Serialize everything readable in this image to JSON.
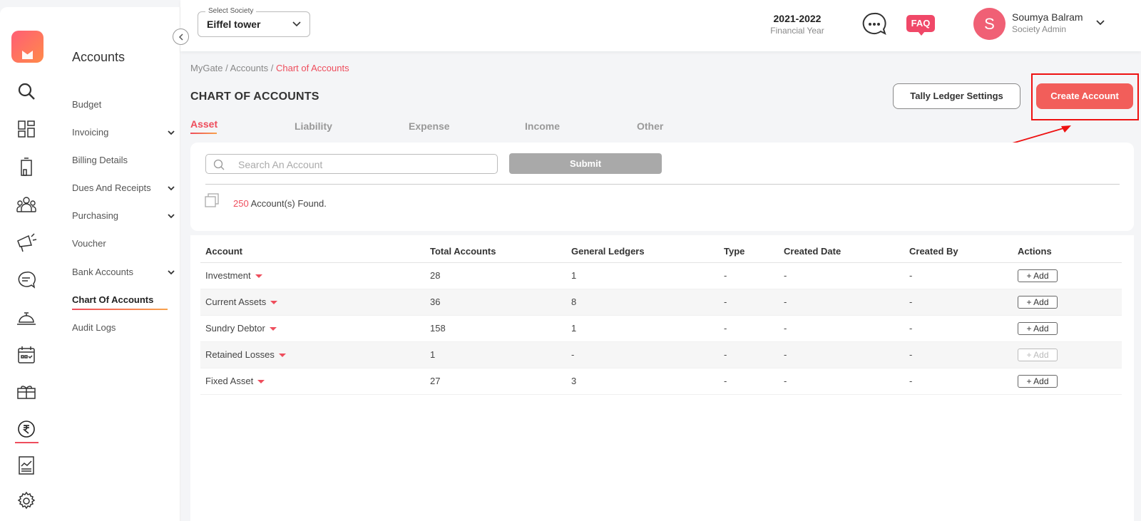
{
  "colors": {
    "accent": "#ee4d5c",
    "primary_button": "#f25e5a",
    "submit_button": "#a9a9a9",
    "annotation": "#e11111"
  },
  "rail": {
    "icons": [
      "search-icon",
      "dashboard-icon",
      "building-icon",
      "users-icon",
      "megaphone-icon",
      "chat-bubble-icon",
      "reception-bell-icon",
      "calendar-icon",
      "gift-icon",
      "rupee-icon",
      "report-icon",
      "gear-icon"
    ],
    "active": "rupee-icon"
  },
  "submenu": {
    "title": "Accounts",
    "items": [
      {
        "label": "Budget",
        "has_chevron": false
      },
      {
        "label": "Invoicing",
        "has_chevron": true
      },
      {
        "label": "Billing Details",
        "has_chevron": false
      },
      {
        "label": "Dues And Receipts",
        "has_chevron": true
      },
      {
        "label": "Purchasing",
        "has_chevron": true
      },
      {
        "label": "Voucher",
        "has_chevron": false
      },
      {
        "label": "Bank Accounts",
        "has_chevron": true
      },
      {
        "label": "Chart Of Accounts",
        "has_chevron": false,
        "active": true
      },
      {
        "label": "Audit Logs",
        "has_chevron": false
      }
    ]
  },
  "header": {
    "society_label": "Select Society",
    "society_value": "Eiffel tower",
    "financial_year": "2021-2022",
    "financial_year_label": "Financial Year",
    "faq_label": "FAQ",
    "user_initial": "S",
    "user_name": "Soumya Balram",
    "user_role": "Society Admin"
  },
  "breadcrumb": {
    "parts": [
      "MyGate",
      "Accounts"
    ],
    "current": "Chart of Accounts",
    "sep": " / "
  },
  "page_title": "CHART OF ACCOUNTS",
  "buttons": {
    "tally": "Tally Ledger Settings",
    "create": "Create Account",
    "submit": "Submit"
  },
  "tabs": [
    {
      "label": "Asset",
      "active": true
    },
    {
      "label": "Liability"
    },
    {
      "label": "Expense"
    },
    {
      "label": "Income"
    },
    {
      "label": "Other"
    }
  ],
  "search": {
    "placeholder": "Search An Account",
    "value": ""
  },
  "result": {
    "count": "250",
    "suffix": " Account(s) Found."
  },
  "table": {
    "headers": [
      "Account",
      "Total Accounts",
      "General Ledgers",
      "Type",
      "Created Date",
      "Created By",
      "Actions"
    ],
    "rows": [
      {
        "account": "Investment",
        "total": "28",
        "ledgers": "1",
        "type": "-",
        "created_date": "-",
        "created_by": "-",
        "action": "+ Add",
        "action_enabled": true
      },
      {
        "account": "Current Assets",
        "total": "36",
        "ledgers": "8",
        "type": "-",
        "created_date": "-",
        "created_by": "-",
        "action": "+ Add",
        "action_enabled": true
      },
      {
        "account": "Sundry Debtor",
        "total": "158",
        "ledgers": "1",
        "type": "-",
        "created_date": "-",
        "created_by": "-",
        "action": "+ Add",
        "action_enabled": true
      },
      {
        "account": "Retained Losses",
        "total": "1",
        "ledgers": "-",
        "type": "-",
        "created_date": "-",
        "created_by": "-",
        "action": "+ Add",
        "action_enabled": false
      },
      {
        "account": "Fixed Asset",
        "total": "27",
        "ledgers": "3",
        "type": "-",
        "created_date": "-",
        "created_by": "-",
        "action": "+ Add",
        "action_enabled": true
      }
    ]
  }
}
